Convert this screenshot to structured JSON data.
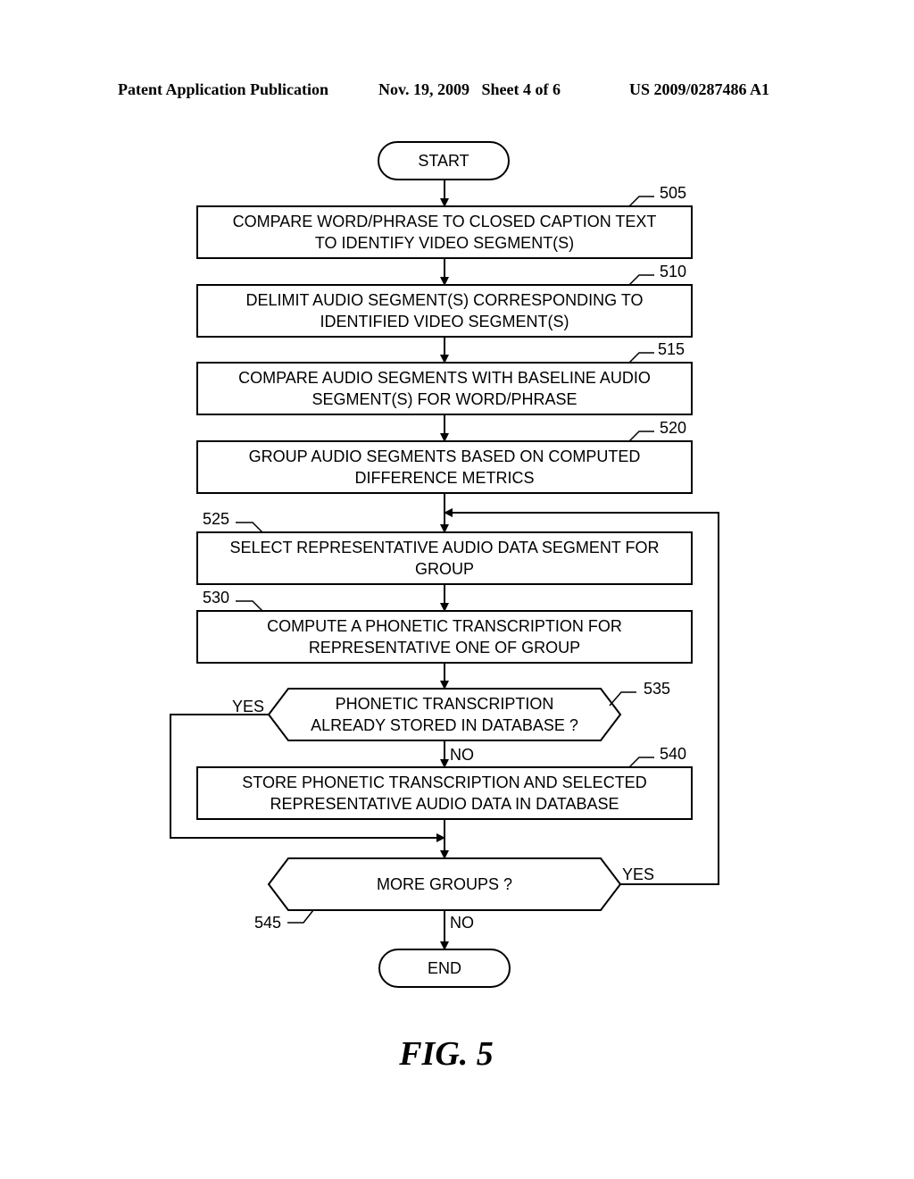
{
  "header": {
    "publication": "Patent Application Publication",
    "date_sheet": "Nov. 19, 2009   Sheet 4 of 6",
    "number": "US 2009/0287486 A1"
  },
  "flowchart": {
    "start": "START",
    "end": "END",
    "steps": [
      {
        "ref": "505",
        "lines": [
          "COMPARE WORD/PHRASE TO CLOSED CAPTION TEXT",
          "TO IDENTIFY VIDEO SEGMENT(S)"
        ]
      },
      {
        "ref": "510",
        "lines": [
          "DELIMIT AUDIO SEGMENT(S) CORRESPONDING TO",
          "IDENTIFIED VIDEO SEGMENT(S)"
        ]
      },
      {
        "ref": "515",
        "lines": [
          "COMPARE AUDIO SEGMENTS WITH BASELINE AUDIO",
          "SEGMENT(S) FOR WORD/PHRASE"
        ]
      },
      {
        "ref": "520",
        "lines": [
          "GROUP AUDIO SEGMENTS BASED ON COMPUTED",
          "DIFFERENCE METRICS"
        ]
      },
      {
        "ref": "525",
        "lines": [
          "SELECT REPRESENTATIVE AUDIO DATA SEGMENT FOR",
          "GROUP"
        ]
      },
      {
        "ref": "530",
        "lines": [
          "COMPUTE A PHONETIC TRANSCRIPTION FOR",
          "REPRESENTATIVE ONE OF GROUP"
        ]
      },
      {
        "ref": "540",
        "lines": [
          "STORE PHONETIC TRANSCRIPTION AND SELECTED",
          "REPRESENTATIVE AUDIO DATA IN DATABASE"
        ]
      }
    ],
    "decisions": [
      {
        "ref": "535",
        "lines": [
          "PHONETIC TRANSCRIPTION",
          "ALREADY STORED IN DATABASE ?"
        ],
        "yes": "YES",
        "no": "NO"
      },
      {
        "ref": "545",
        "lines": [
          "MORE GROUPS ?"
        ],
        "yes": "YES",
        "no": "NO"
      }
    ]
  },
  "figure_label": "FIG. 5"
}
